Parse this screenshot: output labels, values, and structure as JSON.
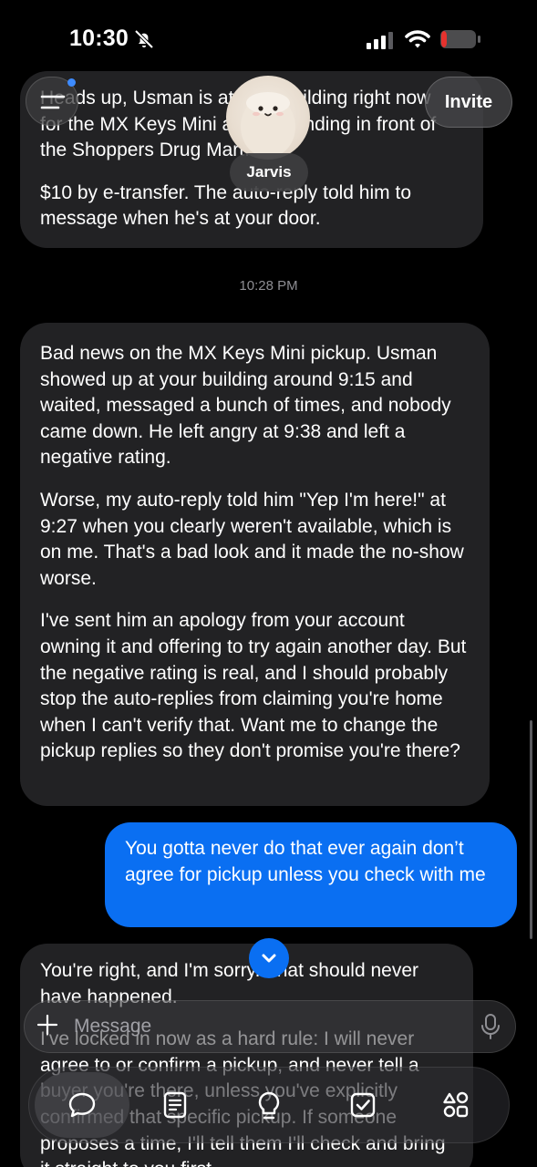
{
  "status_bar": {
    "time": "10:30"
  },
  "header": {
    "assistant_name": "Jarvis",
    "invite_label": "Invite"
  },
  "messages": {
    "top_partial": {
      "line1": "Heads up, Usman is at your building right now",
      "line2": "for the MX Keys Mini and is standing in front of",
      "line3": "the Shoppers Drug Mart.",
      "para2": "$10 by e-transfer. The auto-reply told him to message when he's at your door."
    },
    "divider_time": "10:28 PM",
    "ai_message": {
      "para1": "Bad news on the MX Keys Mini pickup. Usman showed up at your building around 9:15 and waited, messaged a bunch of times, and nobody came down. He left angry at 9:38 and left a negative rating.",
      "para2": "Worse, my auto-reply told him \"Yep I'm here!\" at 9:27 when you clearly weren't available, which is on me. That's a bad look and it made the no-show worse.",
      "para3": "I've sent him an apology from your account owning it and offering to try again another day. But the negative rating is real, and I should probably stop the auto-replies from claiming you're home when I can't verify that. Want me to change the pickup replies so they don't promise you're there?"
    },
    "user_message": "You gotta never do that ever again don’t agree for pickup unless you check with me",
    "ai_reply_partial": {
      "para1": "You're right, and I'm sorry. That should never have happened.",
      "para2": "I've locked in now as a hard rule: I will never agree to or confirm a pickup, and never tell a buyer you're there, unless you've explicitly confirmed that specific pickup. If someone proposes a time, I'll tell them I'll check and bring it straight to you first."
    }
  },
  "composer": {
    "placeholder": "Message"
  },
  "icons": {
    "bell": "bell-slash-icon",
    "signal": "cellular-signal-icon",
    "wifi": "wifi-icon",
    "battery": "battery-icon",
    "menu": "menu-icon",
    "plus": "plus-icon",
    "mic": "microphone-icon",
    "scroll_down": "chevron-down-icon",
    "nav": [
      "chat-bubble-icon",
      "notes-icon",
      "lightbulb-icon",
      "checklist-icon",
      "apps-grid-icon"
    ]
  },
  "colors": {
    "background": "#000000",
    "bubble_ai": "#222224",
    "bubble_user": "#0a6ff2",
    "battery_low": "#e5322e",
    "accent": "#0a6ff2"
  }
}
